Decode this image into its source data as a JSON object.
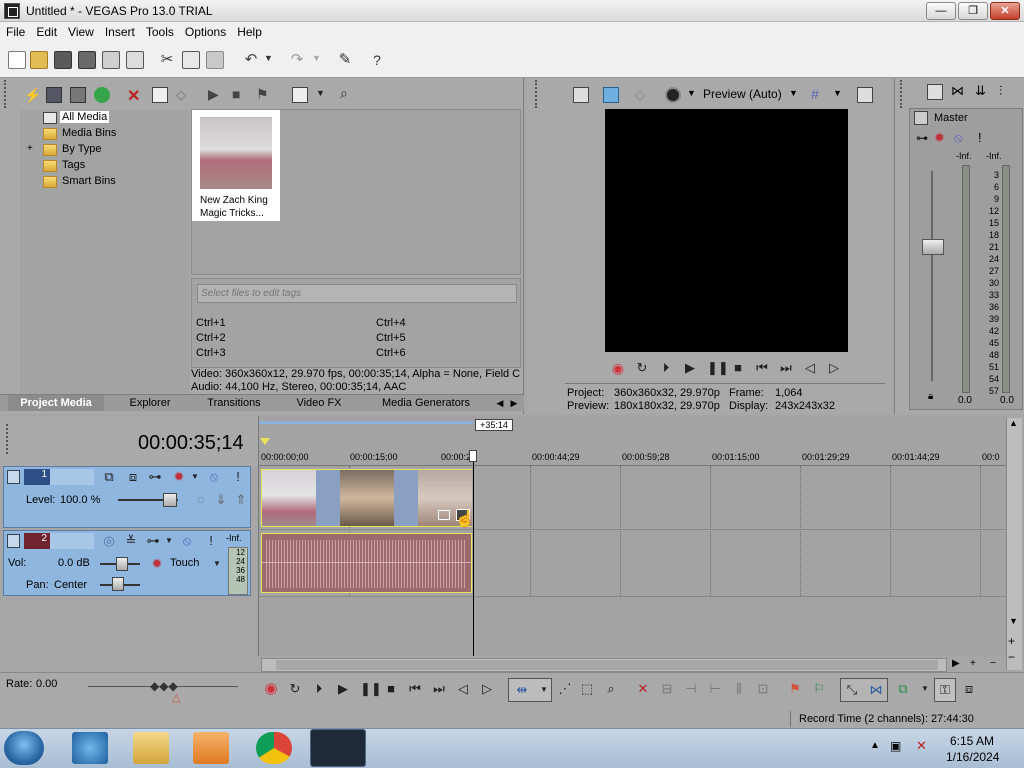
{
  "window": {
    "title": "Untitled * - VEGAS Pro 13.0 TRIAL",
    "minimize": "—",
    "maximize": "❐",
    "close": "✕"
  },
  "menu": [
    "File",
    "Edit",
    "View",
    "Insert",
    "Tools",
    "Options",
    "Help"
  ],
  "media_tree": {
    "items": [
      "All Media",
      "Media Bins",
      "By Type",
      "Tags",
      "Smart Bins"
    ],
    "expander": "+"
  },
  "media_item": {
    "label_line1": "New Zach King",
    "label_line2": "Magic Tricks..."
  },
  "tags": {
    "placeholder": "Select files to edit tags",
    "shortcuts": [
      "Ctrl+1",
      "Ctrl+2",
      "Ctrl+3",
      "Ctrl+4",
      "Ctrl+5",
      "Ctrl+6"
    ]
  },
  "media_info": {
    "video": "Video: 360x360x12, 29.970 fps, 00:00:35;14, Alpha = None, Field C",
    "audio": "Audio: 44,100 Hz, Stereo, 00:00:35;14, AAC"
  },
  "bottom_tabs": [
    "Project Media",
    "Explorer",
    "Transitions",
    "Video FX",
    "Media Generators"
  ],
  "preview": {
    "mode_label": "Preview (Auto)",
    "project_label": "Project:",
    "project_value": "360x360x32, 29.970p",
    "preview_label": "Preview:",
    "preview_value": "180x180x32, 29.970p",
    "frame_label": "Frame:",
    "frame_value": "1,064",
    "display_label": "Display:",
    "display_value": "243x243x32"
  },
  "master": {
    "label": "Master",
    "inf_left": "-Inf.",
    "inf_right": "-Inf.",
    "scale": [
      "3",
      "6",
      "9",
      "12",
      "15",
      "18",
      "21",
      "24",
      "27",
      "30",
      "33",
      "36",
      "39",
      "42",
      "45",
      "48",
      "51",
      "54",
      "57"
    ],
    "val_left": "0.0",
    "val_right": "0.0"
  },
  "timeline": {
    "timecode": "00:00:35;14",
    "cursor_badge": "+35:14",
    "ruler": [
      "00:00:00;00",
      "00:00:15;00",
      "00:00:29",
      "00:00:44;29",
      "00:00:59;28",
      "00:01:15;00",
      "00:01:29;29",
      "00:01:44;29",
      "00:0"
    ]
  },
  "video_track": {
    "number": "1",
    "level_label": "Level:",
    "level_value": "100.0 %"
  },
  "audio_track": {
    "number": "2",
    "vol_label": "Vol:",
    "vol_value": "0.0 dB",
    "pan_label": "Pan:",
    "pan_value": "Center",
    "touch": "Touch",
    "inf": "-Inf.",
    "mini_scale": [
      "12",
      "24",
      "36",
      "48"
    ]
  },
  "transport": {
    "rate_label": "Rate:",
    "rate_value": "0.00"
  },
  "status": {
    "record_time": "Record Time (2 channels): 27:44:30"
  },
  "clock": {
    "time": "6:15 AM",
    "date": "1/16/2024"
  },
  "colors": {
    "accent_blue": "#8fb6de",
    "audio_wave": "#b9878b",
    "clip_border": "#e7e35a",
    "record_red": "#d1323a"
  }
}
